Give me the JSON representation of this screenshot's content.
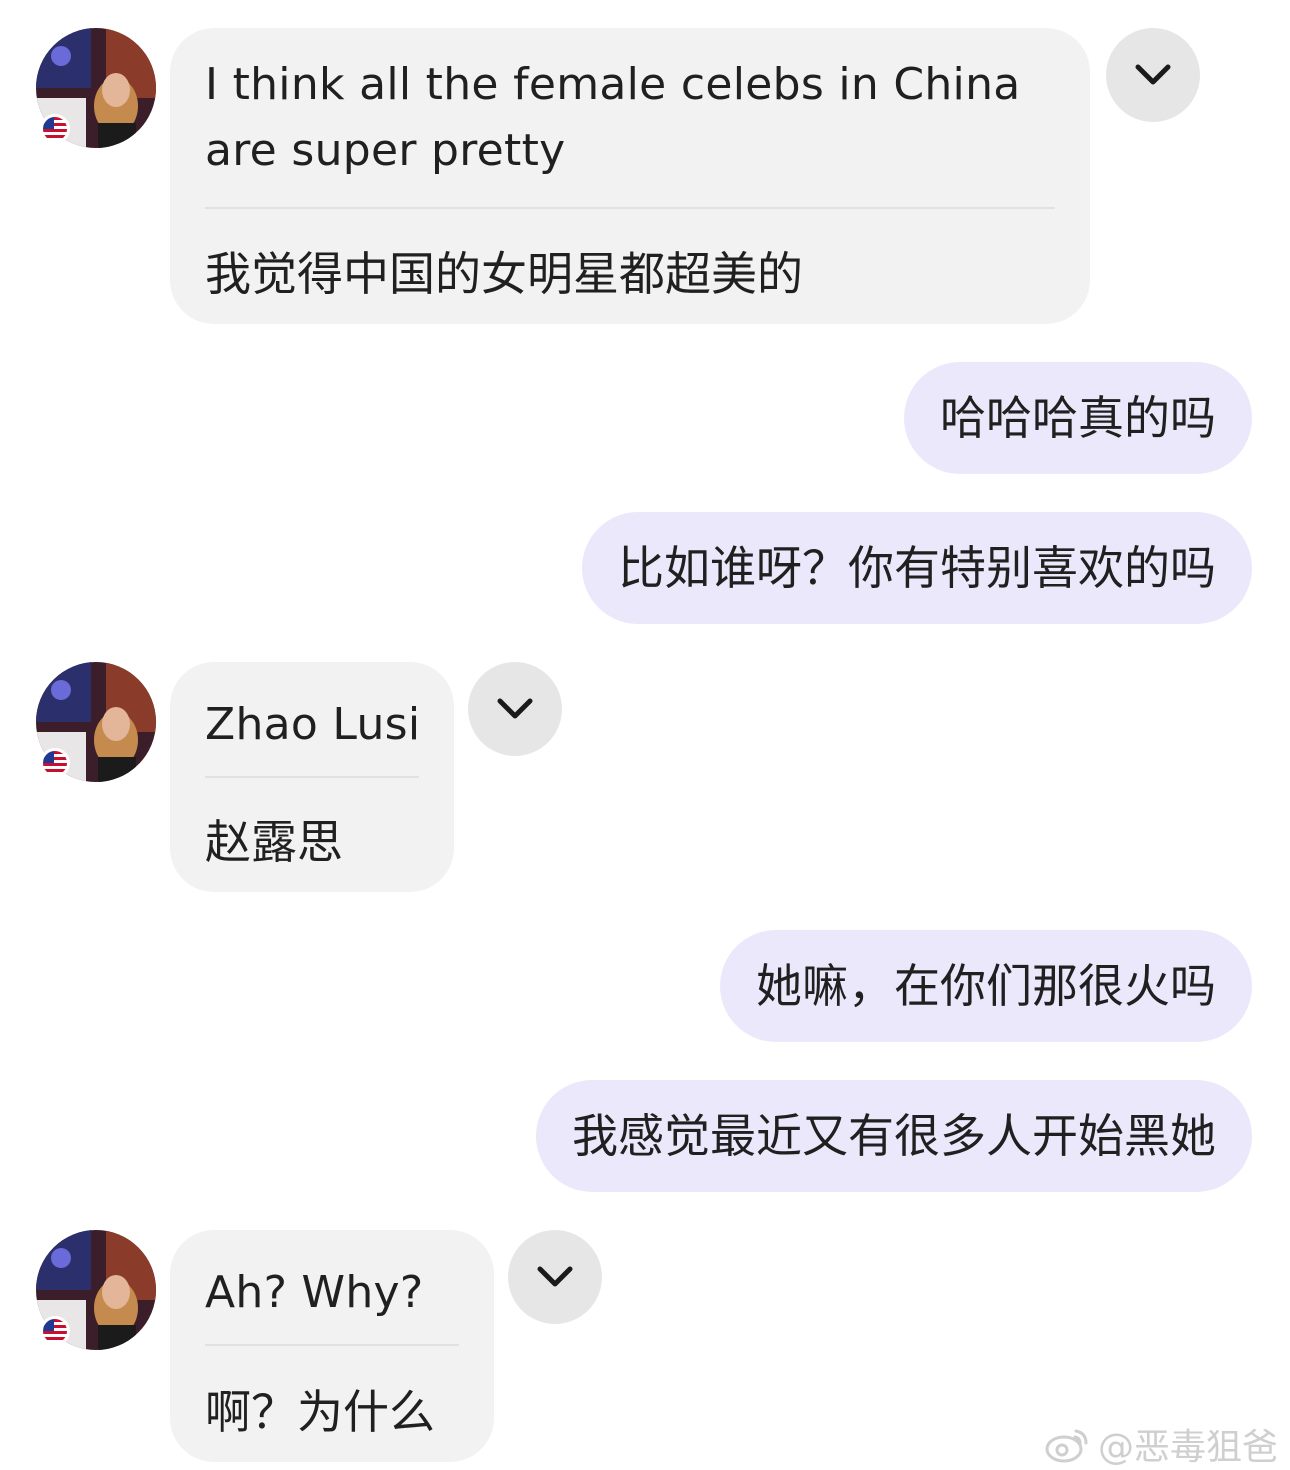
{
  "colors": {
    "incoming_bubble": "#f2f2f2",
    "outgoing_bubble": "#ebe8fb",
    "chevron_button": "#e6e6e6",
    "divider": "#e1e1e1"
  },
  "messages": [
    {
      "direction": "incoming",
      "original": "I think all the female celebs in China are super pretty",
      "translation": "我觉得中国的女明星都超美的",
      "avatar_icon": "user-avatar-photo",
      "badge_icon": "us-flag-icon",
      "menu_icon": "chevron-down-icon"
    },
    {
      "direction": "outgoing",
      "text": "哈哈哈真的吗"
    },
    {
      "direction": "outgoing",
      "text": "比如谁呀？你有特别喜欢的吗"
    },
    {
      "direction": "incoming",
      "original": "Zhao Lusi",
      "translation": "赵露思",
      "avatar_icon": "user-avatar-photo",
      "badge_icon": "us-flag-icon",
      "menu_icon": "chevron-down-icon"
    },
    {
      "direction": "outgoing",
      "text": "她嘛，在你们那很火吗"
    },
    {
      "direction": "outgoing",
      "text": "我感觉最近又有很多人开始黑她"
    },
    {
      "direction": "incoming",
      "original": "Ah? Why?",
      "translation": "啊？为什么",
      "avatar_icon": "user-avatar-photo",
      "badge_icon": "us-flag-icon",
      "menu_icon": "chevron-down-icon"
    }
  ],
  "watermark": {
    "text": "@恶毒狙爸",
    "icon": "weibo-logo-icon"
  }
}
